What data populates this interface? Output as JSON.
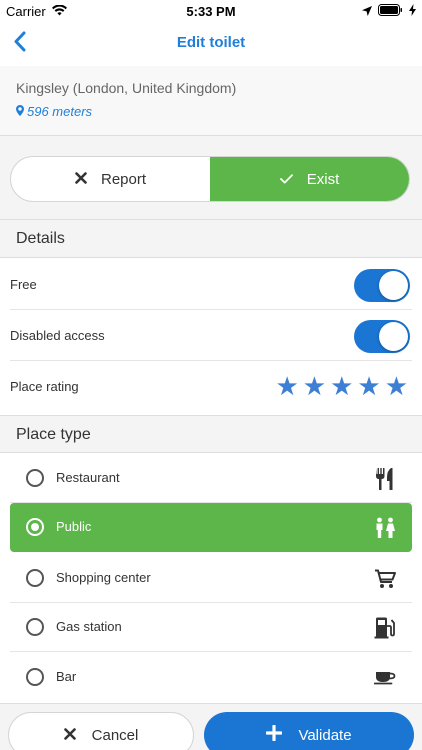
{
  "status_bar": {
    "carrier": "Carrier",
    "time": "5:33 PM"
  },
  "nav": {
    "title": "Edit toilet"
  },
  "location": {
    "name": "Kingsley (London, United Kingdom)",
    "distance": "596 meters"
  },
  "status_segment": {
    "report_label": "Report",
    "exist_label": "Exist",
    "selected": "exist"
  },
  "details": {
    "header": "Details",
    "free_label": "Free",
    "free_on": true,
    "disabled_label": "Disabled access",
    "disabled_on": true,
    "rating_label": "Place rating",
    "rating": 5
  },
  "place_type": {
    "header": "Place type",
    "items": [
      {
        "label": "Restaurant",
        "icon": "restaurant-icon",
        "selected": false
      },
      {
        "label": "Public",
        "icon": "restroom-icon",
        "selected": true
      },
      {
        "label": "Shopping center",
        "icon": "cart-icon",
        "selected": false
      },
      {
        "label": "Gas station",
        "icon": "gas-pump-icon",
        "selected": false
      },
      {
        "label": "Bar",
        "icon": "coffee-cup-icon",
        "selected": false
      }
    ]
  },
  "actions": {
    "cancel_label": "Cancel",
    "validate_label": "Validate"
  },
  "colors": {
    "accent_blue": "#1a76d2",
    "green": "#5cb649",
    "link_blue": "#1f7fd9"
  }
}
